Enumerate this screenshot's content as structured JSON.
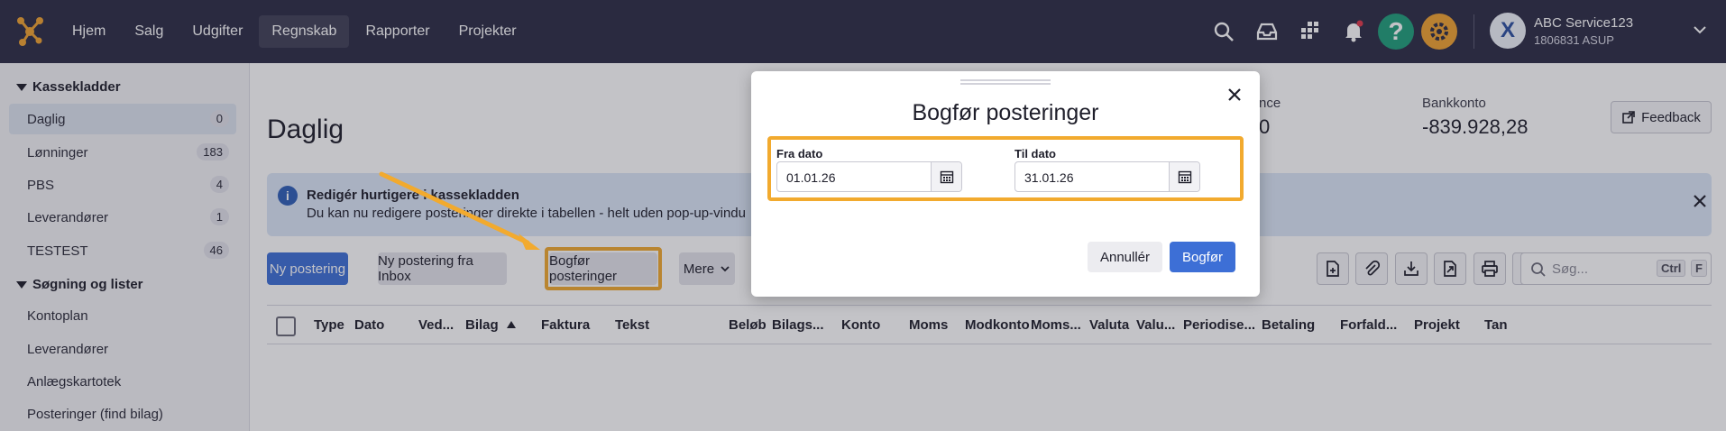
{
  "nav": {
    "items": [
      {
        "label": "Hjem"
      },
      {
        "label": "Salg"
      },
      {
        "label": "Udgifter"
      },
      {
        "label": "Regnskab",
        "active": true
      },
      {
        "label": "Rapporter"
      },
      {
        "label": "Projekter"
      }
    ],
    "icons": [
      "search-icon",
      "inbox-icon",
      "apps-icon",
      "bell-icon",
      "help-icon",
      "gear-icon"
    ]
  },
  "user": {
    "avatar_letter": "X",
    "name": "ABC Service123",
    "sub": "1806831 ASUP"
  },
  "sidebar": {
    "group1": "Kassekladder",
    "journals": [
      {
        "label": "Daglig",
        "count": "0"
      },
      {
        "label": "Lønninger",
        "count": "183"
      },
      {
        "label": "PBS",
        "count": "4"
      },
      {
        "label": "Leverandører",
        "count": "1"
      },
      {
        "label": "TESTEST",
        "count": "46"
      }
    ],
    "group2": "Søgning og lister",
    "lists": [
      {
        "label": "Kontoplan"
      },
      {
        "label": "Leverandører"
      },
      {
        "label": "Anlægskartotek"
      },
      {
        "label": "Posteringer (find bilag)"
      }
    ]
  },
  "main": {
    "title": "Daglig",
    "stat1_label": "nce",
    "stat1_value": "0",
    "stat2_label": "Bankkonto",
    "stat2_value": "-839.928,28",
    "feedback": "Feedback",
    "banner_title": "Redigér hurtigere i kassekladden",
    "banner_text": "Du kan nu redigere posteringer direkte i tabellen - helt uden pop-up-vindu",
    "btn_new": "Ny postering",
    "btn_inbox": "Ny postering fra Inbox",
    "btn_post": "Bogfør posteringer",
    "btn_more": "Mere",
    "search_placeholder": "Søg...",
    "kbd_ctrl": "Ctrl",
    "kbd_f": "F",
    "columns": [
      "Type",
      "Dato",
      "Ved...",
      "Bilag",
      "Faktura",
      "Tekst",
      "Beløb",
      "Bilags...",
      "Konto",
      "Moms",
      "Modkonto",
      "Moms...",
      "Valuta",
      "Valu...",
      "Periodise...",
      "Betaling",
      "Forfald...",
      "Projekt",
      "Tan"
    ]
  },
  "modal": {
    "title": "Bogfør posteringer",
    "from_label": "Fra dato",
    "from_value": "01.01.26",
    "to_label": "Til dato",
    "to_value": "31.01.26",
    "cancel": "Annullér",
    "confirm": "Bogfør"
  },
  "colors": {
    "topbar": "#2b2b45",
    "primary": "#3d6fd6",
    "highlight": "#f2aa2e",
    "help": "#1f9e7a",
    "gear": "#f0a330"
  }
}
